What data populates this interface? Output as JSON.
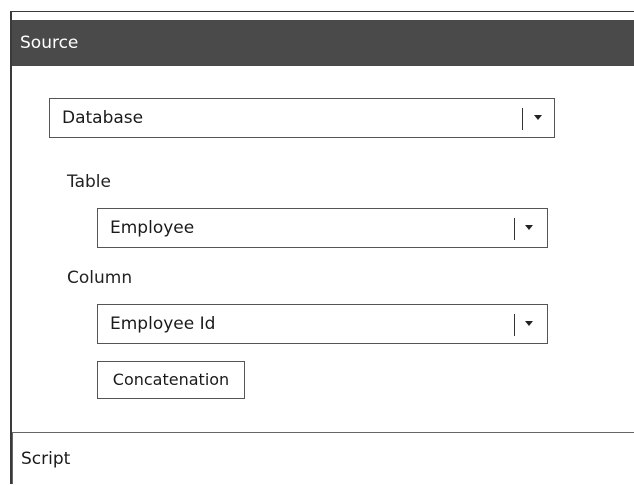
{
  "source_section": {
    "title": "Source"
  },
  "source_type": {
    "selected": "Database"
  },
  "table": {
    "label": "Table",
    "selected": "Employee"
  },
  "column": {
    "label": "Column",
    "selected": "Employee Id"
  },
  "concatenation_button": {
    "label": "Concatenation"
  },
  "script_section": {
    "title": "Script"
  },
  "icons": {
    "dropdown": "chevron-down-icon"
  }
}
